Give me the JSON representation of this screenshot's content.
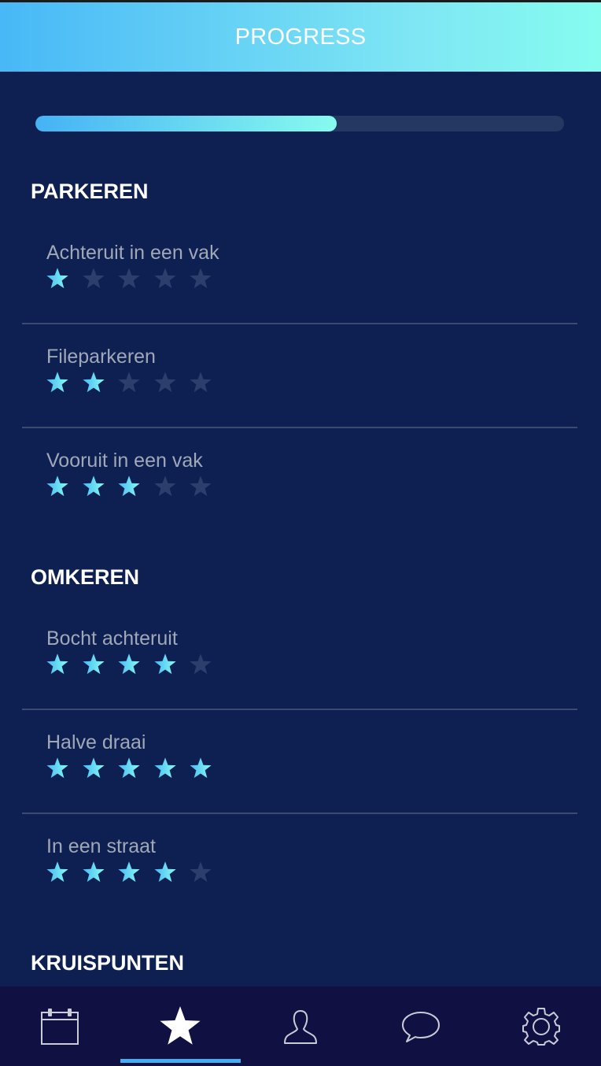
{
  "header": {
    "title": "PROGRESS"
  },
  "progress": {
    "fraction": 0.57
  },
  "colors": {
    "accent": "#48b8f6",
    "accent_end": "#86fcef",
    "background": "#0d2051",
    "star_off": "#2c3e6b",
    "tabbar": "#111042"
  },
  "sections": [
    {
      "title": "PARKEREN",
      "items": [
        {
          "label": "Achteruit in een vak",
          "stars": 1
        },
        {
          "label": "Fileparkeren",
          "stars": 2
        },
        {
          "label": "Vooruit in een vak",
          "stars": 3
        }
      ]
    },
    {
      "title": "OMKEREN",
      "items": [
        {
          "label": "Bocht achteruit",
          "stars": 4
        },
        {
          "label": "Halve draai",
          "stars": 5
        },
        {
          "label": "In een straat",
          "stars": 4
        }
      ]
    },
    {
      "title": "KRUISPUNTEN",
      "items": []
    }
  ],
  "stars_max": 5,
  "tabbar": {
    "tabs": [
      {
        "icon": "calendar-icon",
        "active": false
      },
      {
        "icon": "star-icon",
        "active": true
      },
      {
        "icon": "user-icon",
        "active": false
      },
      {
        "icon": "chat-bubble-icon",
        "active": false
      },
      {
        "icon": "gear-icon",
        "active": false
      }
    ]
  }
}
